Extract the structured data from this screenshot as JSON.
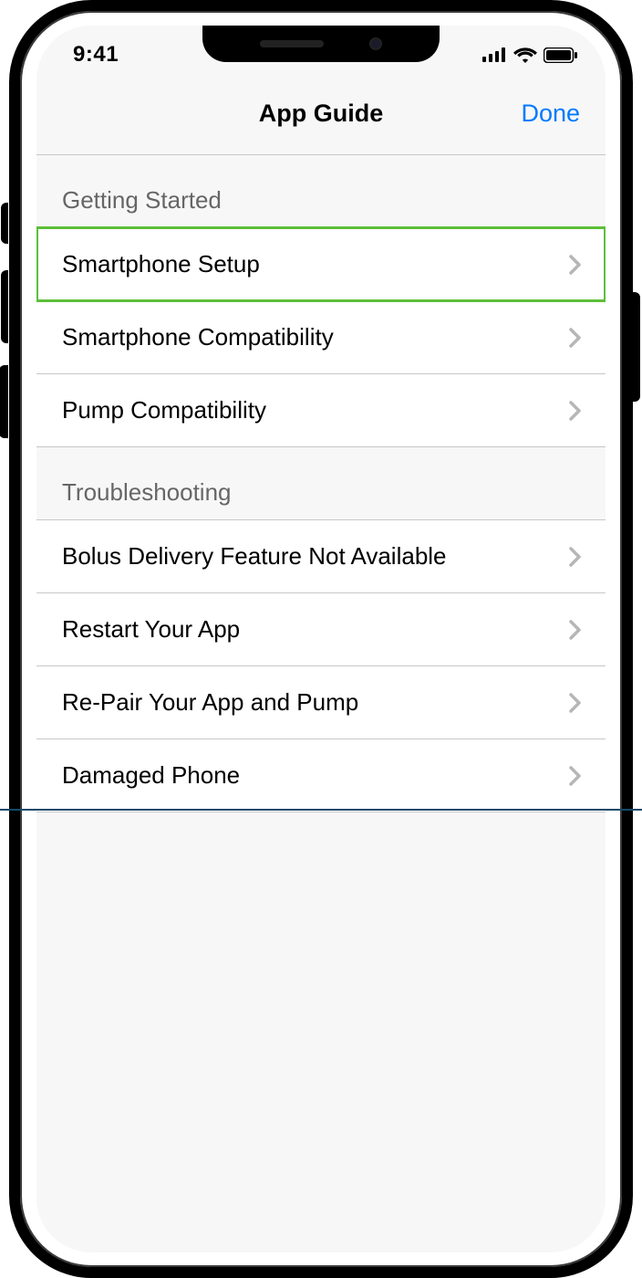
{
  "statusBar": {
    "time": "9:41"
  },
  "navBar": {
    "title": "App Guide",
    "doneLabel": "Done"
  },
  "sections": [
    {
      "header": "Getting Started",
      "items": [
        {
          "label": "Smartphone Setup",
          "highlighted": true
        },
        {
          "label": "Smartphone Compatibility"
        },
        {
          "label": "Pump Compatibility"
        }
      ]
    },
    {
      "header": "Troubleshooting",
      "items": [
        {
          "label": "Bolus Delivery Feature Not Available"
        },
        {
          "label": "Restart Your App"
        },
        {
          "label": "Re-Pair Your App and Pump"
        },
        {
          "label": "Damaged Phone"
        }
      ]
    }
  ]
}
